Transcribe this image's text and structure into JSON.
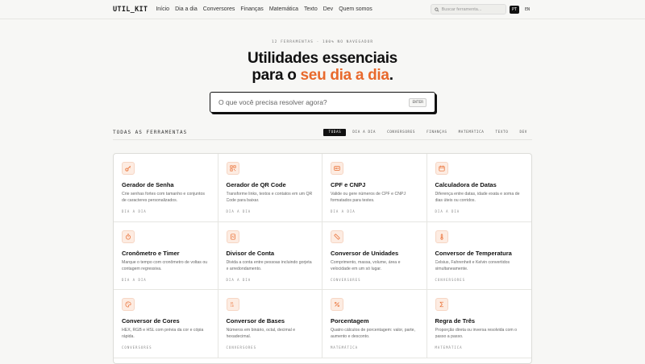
{
  "header": {
    "logo": "UTIL_KIT",
    "nav": [
      "Início",
      "Dia a dia",
      "Conversores",
      "Finanças",
      "Matemática",
      "Texto",
      "Dev",
      "Quem somos"
    ],
    "search_placeholder": "Buscar ferramenta...",
    "languages": [
      {
        "label": "PT",
        "active": true
      },
      {
        "label": "EN",
        "active": false
      }
    ]
  },
  "hero": {
    "eyebrow": "12 FERRAMENTAS · 100% NO NAVEGADOR",
    "title_line1": "Utilidades essenciais",
    "title_pre": "para o ",
    "title_accent": "seu dia a dia",
    "title_post": ".",
    "search_placeholder": "O que você precisa resolver agora?",
    "enter_label": "ENTER"
  },
  "section": {
    "title": "TODAS AS FERRAMENTAS",
    "filters": [
      {
        "label": "TODAS",
        "active": true
      },
      {
        "label": "DIA A DIA",
        "active": false
      },
      {
        "label": "CONVERSORES",
        "active": false
      },
      {
        "label": "FINANÇAS",
        "active": false
      },
      {
        "label": "MATEMÁTICA",
        "active": false
      },
      {
        "label": "TEXTO",
        "active": false
      },
      {
        "label": "DEV",
        "active": false
      }
    ]
  },
  "tools": [
    {
      "icon": "key-icon",
      "title": "Gerador de Senha",
      "desc": "Crie senhas fortes com tamanho e conjuntos de caracteres personalizados.",
      "category": "DIA A DIA"
    },
    {
      "icon": "qr-code-icon",
      "title": "Gerador de QR Code",
      "desc": "Transforme links, textos e contatos em um QR Code para baixar.",
      "category": "DIA A DIA"
    },
    {
      "icon": "id-card-icon",
      "title": "CPF e CNPJ",
      "desc": "Valide ou gere números de CPF e CNPJ formatados para testes.",
      "category": "DIA A DIA"
    },
    {
      "icon": "calendar-icon",
      "title": "Calculadora de Datas",
      "desc": "Diferença entre datas, idade exata e soma de dias úteis ou corridos.",
      "category": "DIA A DIA"
    },
    {
      "icon": "timer-icon",
      "title": "Cronômetro e Timer",
      "desc": "Marque o tempo com cronômetro de voltas ou contagem regressiva.",
      "category": "DIA A DIA"
    },
    {
      "icon": "receipt-icon",
      "title": "Divisor de Conta",
      "desc": "Divida a conta entre pessoas incluindo gorjeta e arredondamento.",
      "category": "DIA A DIA"
    },
    {
      "icon": "ruler-icon",
      "title": "Conversor de Unidades",
      "desc": "Comprimento, massa, volume, área e velocidade em um só lugar.",
      "category": "CONVERSORES"
    },
    {
      "icon": "thermometer-icon",
      "title": "Conversor de Temperatura",
      "desc": "Celsius, Fahrenheit e Kelvin convertidos simultaneamente.",
      "category": "CONVERSORES"
    },
    {
      "icon": "palette-icon",
      "title": "Conversor de Cores",
      "desc": "HEX, RGB e HSL com prévia da cor e cópia rápida.",
      "category": "CONVERSORES"
    },
    {
      "icon": "binary-icon",
      "title": "Conversor de Bases",
      "desc": "Números em binário, octal, decimal e hexadecimal.",
      "category": "CONVERSORES"
    },
    {
      "icon": "percent-icon",
      "title": "Porcentagem",
      "desc": "Quatro cálculos de porcentagem: valor, parte, aumento e desconto.",
      "category": "MATEMÁTICA"
    },
    {
      "icon": "sigma-icon",
      "title": "Regra de Três",
      "desc": "Proporção direta ou inversa resolvida com o passo a passo.",
      "category": "MATEMÁTICA"
    }
  ],
  "colors": {
    "accent": "#e8692c",
    "ink": "#111111",
    "icon_bg": "#fdece2"
  }
}
